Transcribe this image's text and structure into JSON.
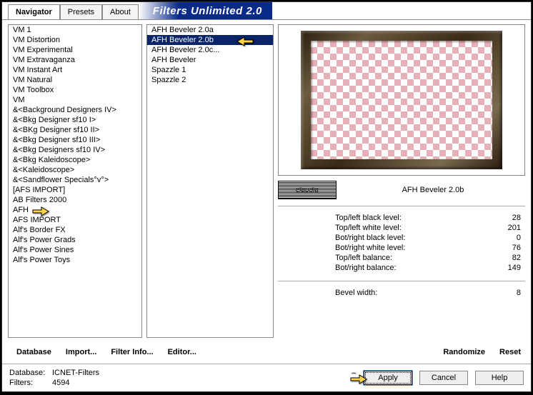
{
  "tabs": {
    "navigator": "Navigator",
    "presets": "Presets",
    "about": "About"
  },
  "title": "Filters Unlimited 2.0",
  "categories": [
    "VM 1",
    "VM Distortion",
    "VM Experimental",
    "VM Extravaganza",
    "VM Instant Art",
    "VM Natural",
    "VM Toolbox",
    "VM",
    "&<Background Designers IV>",
    "&<Bkg Designer sf10 I>",
    "&<BKg Designer sf10 II>",
    "&<Bkg Designer sf10 III>",
    "&<Bkg Designers sf10 IV>",
    "&<Bkg Kaleidoscope>",
    "&<Kaleidoscope>",
    "&<Sandflower Specials°v°>",
    "[AFS IMPORT]",
    "AB Filters 2000",
    "AFH",
    "AFS IMPORT",
    "Alf's Border FX",
    "Alf's Power Grads",
    "Alf's Power Sines",
    "Alf's Power Toys"
  ],
  "categories_selected_index": 18,
  "filters": [
    "AFH Beveler 2.0a",
    "AFH Beveler 2.0b",
    "AFH Beveler 2.0c...",
    "AFH Beveler",
    "Spazzle 1",
    "Spazzle 2"
  ],
  "filters_selected_index": 1,
  "filter_title": "AFH Beveler 2.0b",
  "logo_text": "claudia",
  "params": [
    {
      "label": "Top/left black level:",
      "value": "28"
    },
    {
      "label": "Top/left white level:",
      "value": "201"
    },
    {
      "label": "Bot/right black level:",
      "value": "0"
    },
    {
      "label": "Bot/right white level:",
      "value": "76"
    },
    {
      "label": "Top/left balance:",
      "value": "82"
    },
    {
      "label": "Bot/right balance:",
      "value": "149"
    }
  ],
  "bevel_param": {
    "label": "Bevel width:",
    "value": "8"
  },
  "buttons": {
    "database": "Database",
    "import": "Import...",
    "filter_info": "Filter Info...",
    "editor": "Editor...",
    "randomize": "Randomize",
    "reset": "Reset",
    "apply": "Apply",
    "cancel": "Cancel",
    "help": "Help"
  },
  "status": {
    "database_label": "Database:",
    "database_value": "ICNET-Filters",
    "filters_label": "Filters:",
    "filters_value": "4594"
  }
}
